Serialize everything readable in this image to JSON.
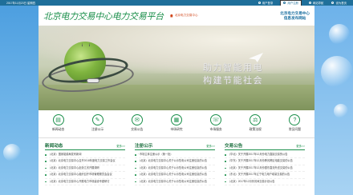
{
  "topbar": {
    "date": "2017年11月23日 星期四",
    "items": [
      "用户登录",
      "用户注册",
      "网站导航",
      "设为首页"
    ]
  },
  "header": {
    "logo": "北京电力交易中心电力交易平台",
    "sublogo": "北京电力交易中心",
    "right_line1": "北京电力交易中心",
    "right_line2": "信息发布网站"
  },
  "banner": {
    "line1": "助力智能用电",
    "line2": "构建节能社会",
    "pages": [
      "1",
      "2",
      "3",
      "4"
    ],
    "active_page": "4"
  },
  "nav_icons": [
    {
      "label": "新闻动态",
      "icon": "newspaper-icon",
      "glyph": "▤"
    },
    {
      "label": "注册公示",
      "icon": "clipboard-icon",
      "glyph": "✎"
    },
    {
      "label": "交易公告",
      "icon": "announcement-icon",
      "glyph": "✉"
    },
    {
      "label": "市场研究",
      "icon": "chart-icon",
      "glyph": "▦"
    },
    {
      "label": "市场服务",
      "icon": "service-icon",
      "glyph": "☏"
    },
    {
      "label": "政策法规",
      "icon": "law-icon",
      "glyph": "⚖"
    },
    {
      "label": "常见问题",
      "icon": "question-icon",
      "glyph": "?"
    }
  ],
  "columns": {
    "news": {
      "title": "新闻动态",
      "more": "更多>>",
      "items": [
        "（北京）国家能源局发布新闻",
        "（北京）北京电力交易中心召开2018年度电力交易工作会议",
        "（北京）北京电力交易中心赴浙江省开展调研",
        "（北京）北京电力交易中心组织召开市场管理委员会会议",
        "（北京）北京电力交易中心开展电力市场建设专题研讨"
      ]
    },
    "registration": {
      "title": "注册公示",
      "more": "更多>>",
      "items": [
        "· 市场主体注册公示（第一批）",
        "（北京）北京电力交易中心关于公示售电公司注册信息的公告",
        "（北京）北京电力交易中心关于公示售电公司注册信息的公告",
        "（北京）北京电力交易中心关于公示售电公司注册信息的公告",
        "（北京）北京电力交易中心关于公示售电公司注册信息的公告"
      ]
    },
    "trade": {
      "title": "交易公告",
      "more": "更多>>",
      "items": [
        "（华北）关于开展2017年12月份电力直接交易的公告",
        "（华东）关于开展2017年12月份跨省跨区电能交易的公告",
        "（北京）关于开展2017年12月份银东直流外送交易的公告",
        "（东北）关于开展2017年辽宁电力用户增量交易的公告",
        "（北京）2017年12月份省间交易计划公告"
      ]
    }
  }
}
